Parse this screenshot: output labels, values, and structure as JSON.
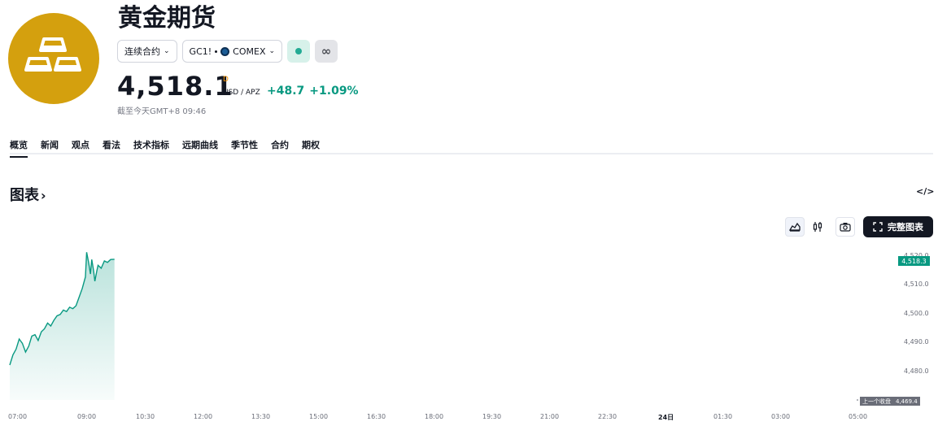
{
  "header": {
    "title": "黄金期货",
    "contract_type": "连续合约",
    "symbol": "GC1!",
    "exchange": "COMEX",
    "price": "4,518.1",
    "price_flag": "D",
    "unit": "USD / APZ",
    "change": "+48.7",
    "change_pct": "+1.09%",
    "as_of": "截至今天GMT+8 09:46"
  },
  "tabs": [
    "概览",
    "新闻",
    "观点",
    "看法",
    "技术指标",
    "远期曲线",
    "季节性",
    "合约",
    "期权"
  ],
  "section": {
    "title": "图表",
    "full_chart_label": "完整图表",
    "embed_label": "</>"
  },
  "colors": {
    "accent": "#089981",
    "logo": "#d4a00e",
    "live_dot": "#22ab94"
  },
  "chart_data": {
    "type": "area",
    "x": [
      "07:00",
      "07:05",
      "07:10",
      "07:15",
      "07:20",
      "07:25",
      "07:30",
      "07:35",
      "07:40",
      "07:45",
      "07:50",
      "07:55",
      "08:00",
      "08:05",
      "08:10",
      "08:15",
      "08:20",
      "08:25",
      "08:30",
      "08:35",
      "08:40",
      "08:45",
      "08:50",
      "08:55",
      "09:00",
      "09:02",
      "09:05",
      "09:08",
      "09:10",
      "09:13",
      "09:15",
      "09:18",
      "09:20",
      "09:25",
      "09:30",
      "09:35",
      "09:40",
      "09:46"
    ],
    "values": [
      4481.5,
      4485,
      4487,
      4490.5,
      4489,
      4486,
      4488,
      4491.5,
      4492,
      4490,
      4493,
      4494,
      4496,
      4495,
      4497,
      4498.5,
      4499,
      4500.5,
      4500,
      4501.5,
      4501,
      4502,
      4505,
      4508,
      4512,
      4520.5,
      4517,
      4513,
      4518,
      4514,
      4510.5,
      4514,
      4516,
      4515,
      4517.5,
      4517,
      4518,
      4518.1
    ],
    "x_ticks": [
      "07:00",
      "09:00",
      "10:30",
      "12:00",
      "13:30",
      "15:00",
      "16:30",
      "18:00",
      "19:30",
      "21:00",
      "22:30",
      "24日",
      "01:30",
      "03:00",
      "05:00"
    ],
    "y_ticks": [
      "4,480.0",
      "4,490.0",
      "4,500.0",
      "4,510.0",
      "4,520.0"
    ],
    "ylim": [
      4469.4,
      4522
    ],
    "current_price_label": "4,518.3",
    "prev_close_label": "上一个收盘",
    "prev_close_value": "4,469.4",
    "grid": false
  }
}
